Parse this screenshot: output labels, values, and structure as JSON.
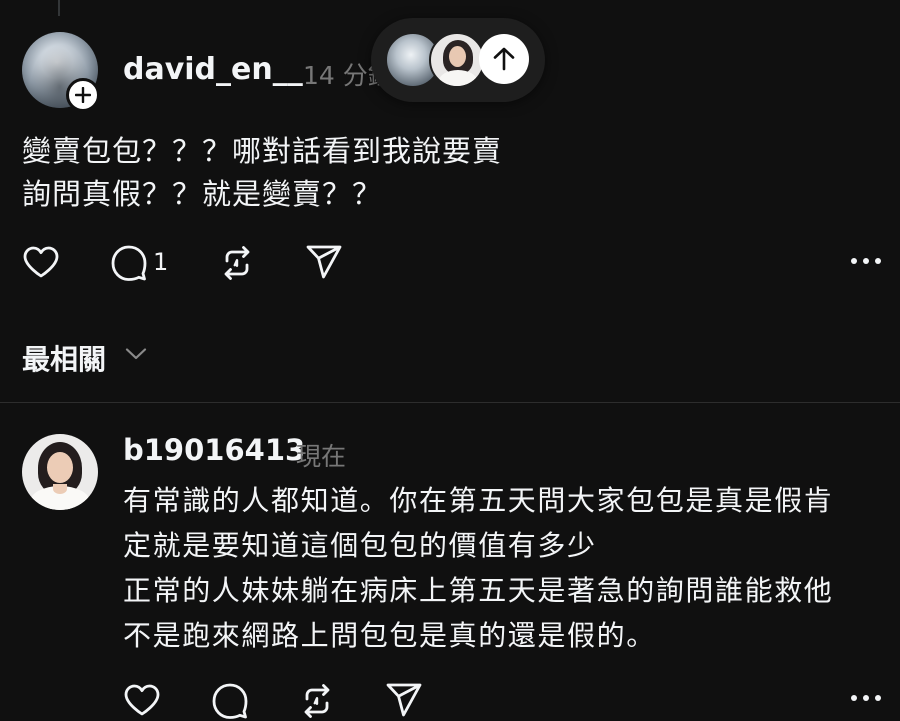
{
  "post": {
    "username": "david_en__",
    "time": "14 分鐘",
    "lines": [
      "變賣包包？？？哪對話看到我說要賣",
      "詢問真假？？就是變賣？？"
    ],
    "reply_count": "1"
  },
  "sort": {
    "label": "最相關"
  },
  "reply": {
    "username": "b19016413",
    "time": "現在",
    "lines": [
      "有常識的人都知道。你在第五天問大家包包是真是假肯",
      "定就是要知道這個包包的價值有多少",
      "正常的人妹妹躺在病床上第五天是著急的詢問誰能救他",
      "不是跑來網路上問包包是真的還是假的。"
    ]
  },
  "icons": {
    "like": "heart-icon",
    "comment": "comment-bubble-icon",
    "repost": "repost-icon",
    "share": "send-icon",
    "more": "more-dots-icon",
    "follow": "plus-icon",
    "scroll_top": "arrow-up-icon",
    "dropdown": "chevron-down-icon"
  },
  "colors": {
    "background": "#101010",
    "text": "#f3f5f7",
    "muted": "#777777",
    "divider": "#2d2d2d"
  }
}
